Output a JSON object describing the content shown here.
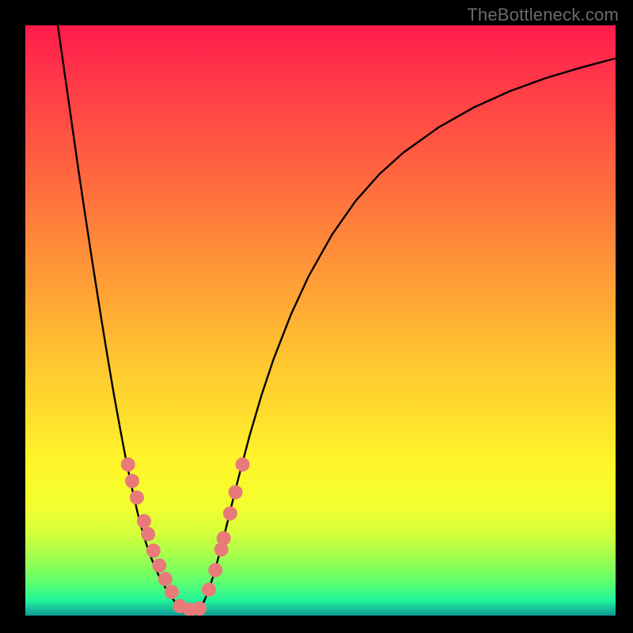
{
  "watermark": "TheBottleneck.com",
  "colors": {
    "curve": "#000000",
    "dot_fill": "#e97a7a",
    "dot_stroke": "#8a2f2f"
  },
  "chart_data": {
    "type": "line",
    "title": "",
    "xlabel": "",
    "ylabel": "",
    "xlim": [
      0,
      1
    ],
    "ylim": [
      0,
      1
    ],
    "series": [
      {
        "name": "bottleneck-curve",
        "x": [
          0.055,
          0.06,
          0.07,
          0.08,
          0.09,
          0.1,
          0.11,
          0.12,
          0.13,
          0.14,
          0.15,
          0.16,
          0.17,
          0.18,
          0.19,
          0.2,
          0.21,
          0.22,
          0.23,
          0.24,
          0.25,
          0.255,
          0.262,
          0.268,
          0.275,
          0.282,
          0.29,
          0.3,
          0.31,
          0.32,
          0.33,
          0.34,
          0.35,
          0.36,
          0.38,
          0.4,
          0.42,
          0.45,
          0.48,
          0.52,
          0.56,
          0.6,
          0.64,
          0.7,
          0.76,
          0.82,
          0.88,
          0.94,
          1.0
        ],
        "y": [
          1.0,
          0.965,
          0.895,
          0.825,
          0.755,
          0.688,
          0.622,
          0.558,
          0.495,
          0.434,
          0.375,
          0.32,
          0.267,
          0.219,
          0.175,
          0.137,
          0.106,
          0.081,
          0.06,
          0.043,
          0.028,
          0.021,
          0.013,
          0.007,
          0.004,
          0.003,
          0.006,
          0.018,
          0.041,
          0.072,
          0.109,
          0.148,
          0.189,
          0.229,
          0.305,
          0.373,
          0.433,
          0.51,
          0.575,
          0.646,
          0.703,
          0.748,
          0.784,
          0.827,
          0.861,
          0.888,
          0.91,
          0.928,
          0.944
        ]
      }
    ],
    "scatter": {
      "name": "highlight-dots",
      "x": [
        0.174,
        0.181,
        0.189,
        0.201,
        0.208,
        0.217,
        0.227,
        0.237,
        0.248,
        0.262,
        0.279,
        0.295,
        0.311,
        0.322,
        0.332,
        0.336,
        0.347,
        0.356,
        0.368
      ],
      "y": [
        0.256,
        0.228,
        0.2,
        0.16,
        0.138,
        0.11,
        0.085,
        0.062,
        0.04,
        0.016,
        0.01,
        0.012,
        0.044,
        0.077,
        0.112,
        0.131,
        0.173,
        0.209,
        0.256
      ]
    }
  }
}
